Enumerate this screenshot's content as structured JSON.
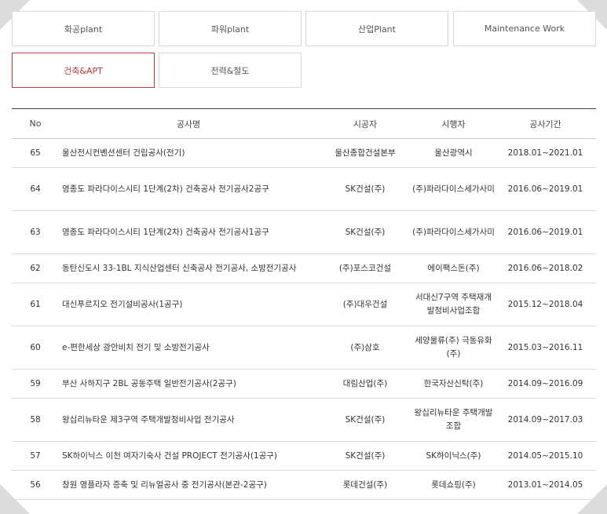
{
  "tabs": [
    {
      "label": "화공plant",
      "active": false
    },
    {
      "label": "파워plant",
      "active": false
    },
    {
      "label": "산업Plant",
      "active": false
    },
    {
      "label": "Maintenance Work",
      "active": false
    },
    {
      "label": "건축&APT",
      "active": true
    },
    {
      "label": "전력&철도",
      "active": false
    }
  ],
  "table": {
    "headers": [
      "No",
      "공사명",
      "시공자",
      "시행자",
      "공사기간"
    ],
    "rows": [
      {
        "no": "65",
        "name": "울산전시컨벤션센터 건립공사(전기)",
        "contractor": "울산종합건설본부",
        "client": "울산광역시",
        "period": "2018.01~2021.01"
      },
      {
        "no": "64",
        "name": "영종도 파라다이스시티 1단계(2차) 건축공사 전기공사2공구",
        "contractor": "SK건설(주)",
        "client": "(주)파라다이스세가사미",
        "period": "2016.06~2019.01"
      },
      {
        "no": "63",
        "name": "영종도 파라다이스시티 1단계(2차) 건축공사 전기공사1공구",
        "contractor": "SK건설(주)",
        "client": "(주)파라다이스세가사미",
        "period": "2016.06~2019.01"
      },
      {
        "no": "62",
        "name": "동탄신도시 33-1BL 지식산업센터 신축공사 전기공사, 소방전기공사",
        "contractor": "(주)포스코건설",
        "client": "에이팩스돈(주)",
        "period": "2016.06~2018.02"
      },
      {
        "no": "61",
        "name": "대신푸르지오 전기설비공사(1공구)",
        "contractor": "(주)대우건설",
        "client": "서대신7구역 주택재개발정비사업조합",
        "period": "2015.12~2018.04"
      },
      {
        "no": "60",
        "name": "e-편한세상 광안비치 전기 및 소방전기공사",
        "contractor": "(주)삼호",
        "client": "세양물류(주) 극동유화(주)",
        "period": "2015.03~2016.11"
      },
      {
        "no": "59",
        "name": "부산 사하지구 2BL 공동주택 일반전기공사(2공구)",
        "contractor": "대림산업(주)",
        "client": "한국자산신탁(주)",
        "period": "2014.09~2016.09"
      },
      {
        "no": "58",
        "name": "왕십리뉴타운 제3구역 주택개발정비사업 전기공사",
        "contractor": "SK건설(주)",
        "client": "왕십리뉴타운 주택개발조합",
        "period": "2014.09~2017.03"
      },
      {
        "no": "57",
        "name": "SK하이닉스 이천 여자기숙사 건설 PROJECT 전기공사(1공구)",
        "contractor": "SK건설(주)",
        "client": "SK하이닉스(주)",
        "period": "2014.05~2015.10"
      },
      {
        "no": "56",
        "name": "창원 영플라자 증축 및 리뉴얼공사 중 전기공사(본관-2공구)",
        "contractor": "롯데건설(주)",
        "client": "롯데쇼핑(주)",
        "period": "2013.01~2014.05"
      }
    ]
  },
  "colors": {
    "accent": "#c0393b",
    "border": "#d9d9d9",
    "corner": "#dcdcdc"
  }
}
